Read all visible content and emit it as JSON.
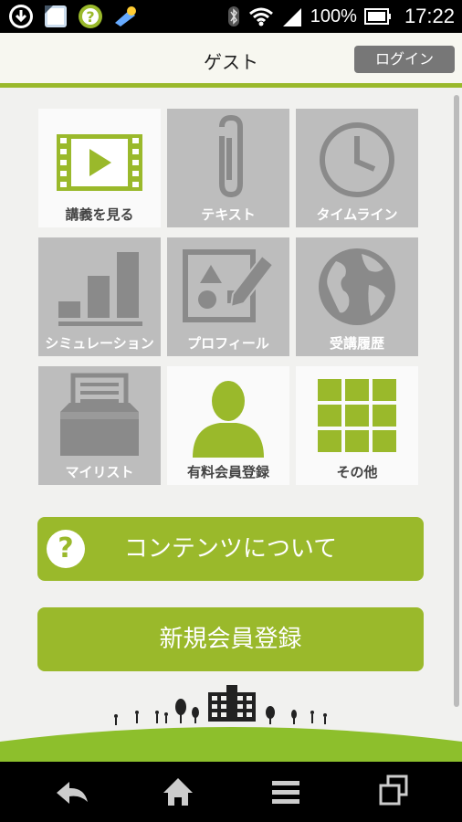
{
  "status_bar": {
    "battery": "100%",
    "time": "17:22"
  },
  "header": {
    "title": "ゲスト",
    "login_label": "ログイン"
  },
  "menu": [
    {
      "label": "講義を見る",
      "icon": "video-icon"
    },
    {
      "label": "テキスト",
      "icon": "paperclip-icon"
    },
    {
      "label": "タイムライン",
      "icon": "clock-icon"
    },
    {
      "label": "シミュレーション",
      "icon": "bar-chart-icon"
    },
    {
      "label": "プロフィール",
      "icon": "profile-edit-icon"
    },
    {
      "label": "受講履歴",
      "icon": "globe-icon"
    },
    {
      "label": "マイリスト",
      "icon": "tray-icon"
    },
    {
      "label": "有料会員登録",
      "icon": "person-icon"
    },
    {
      "label": "その他",
      "icon": "grid-icon"
    }
  ],
  "buttons": {
    "about_contents": "コンテンツについて",
    "register": "新規会員登録"
  },
  "colors": {
    "accent": "#9ab92b",
    "tile_inactive": "#bdbdbd",
    "tile_active": "#fafafa"
  }
}
